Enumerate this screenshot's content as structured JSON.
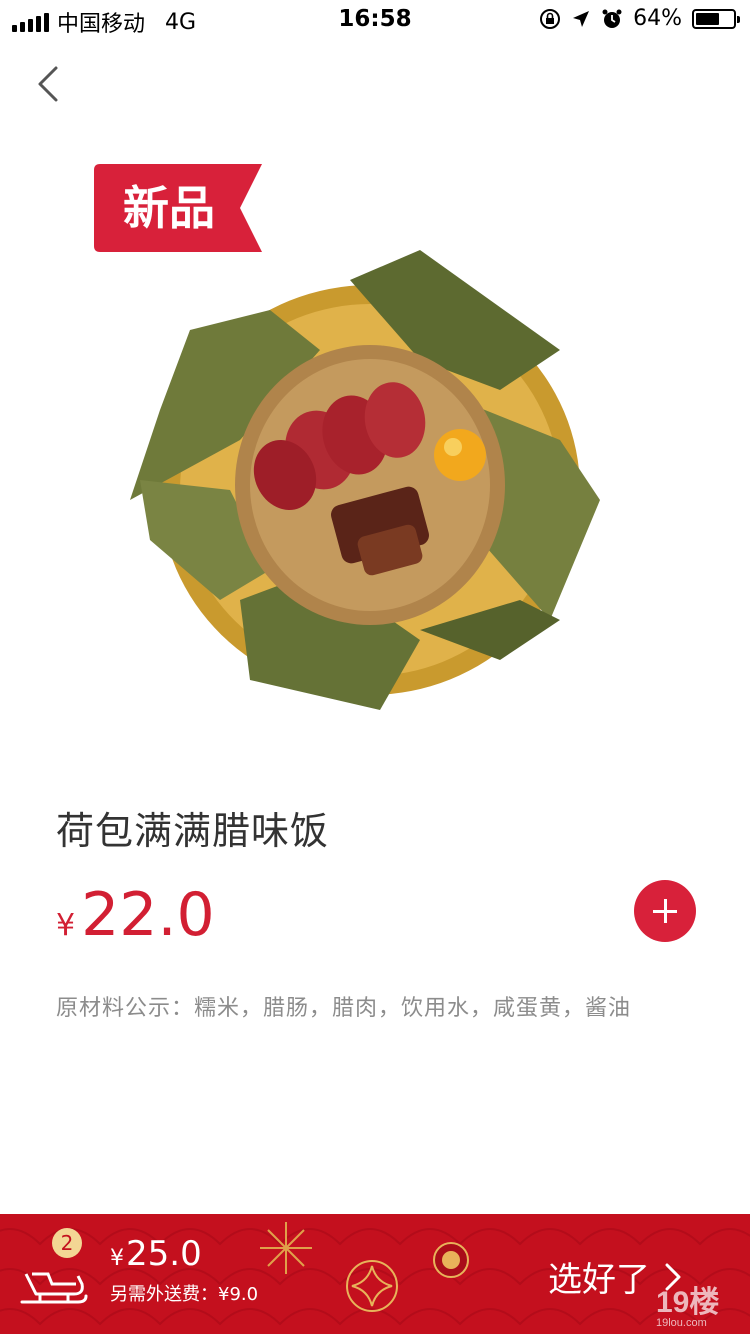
{
  "status_bar": {
    "carrier": "中国移动",
    "network": "4G",
    "time": "16:58",
    "battery_text": "64%",
    "battery_level": 0.64
  },
  "product": {
    "badge": "新品",
    "name": "荷包满满腊味饭",
    "currency": "¥",
    "price": "22.0",
    "ingredients": "原材料公示：糯米，腊肠，腊肉，饮用水，咸蛋黄，酱油"
  },
  "cart": {
    "count": "2",
    "currency": "¥",
    "total": "25.0",
    "delivery_fee": "另需外送费：¥9.0",
    "checkout_label": "选好了"
  },
  "watermark": {
    "text": "19楼",
    "subtext": "19lou.com"
  },
  "colors": {
    "accent": "#d8213a",
    "cart_bar": "#c4101e",
    "gold": "#f3d694"
  }
}
